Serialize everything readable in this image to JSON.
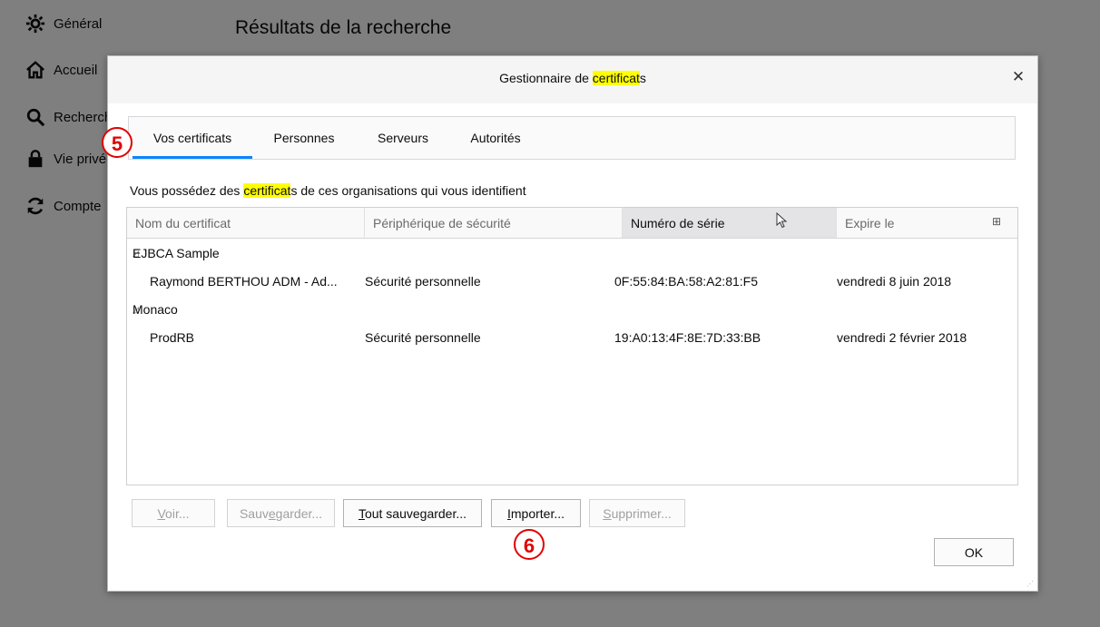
{
  "background": {
    "sidebar": [
      {
        "label": "Général",
        "icon": "gear-icon"
      },
      {
        "label": "Accueil",
        "icon": "home-icon"
      },
      {
        "label": "Recherche",
        "icon": "search-icon"
      },
      {
        "label": "Vie privée",
        "icon": "lock-icon"
      },
      {
        "label": "Compte",
        "icon": "sync-icon"
      }
    ],
    "heading": "Résultats de la recherche"
  },
  "dialog": {
    "title_before": "Gestionnaire de ",
    "title_highlight": "certificat",
    "title_after": "s",
    "tabs": [
      "Vos certificats",
      "Personnes",
      "Serveurs",
      "Autorités"
    ],
    "description_before": "Vous possédez des ",
    "description_highlight": "certificat",
    "description_after": "s de ces organisations qui vous identifient",
    "columns": [
      "Nom du certificat",
      "Périphérique de sécurité",
      "Numéro de série",
      "Expire le"
    ],
    "groups": [
      {
        "name": "EJBCA Sample",
        "certificate": {
          "name": "Raymond BERTHOU ADM - Ad...",
          "device": "Sécurité personnelle",
          "serial": "0F:55:84:BA:58:A2:81:F5",
          "expires": "vendredi 8 juin 2018"
        }
      },
      {
        "name": "Monaco",
        "certificate": {
          "name": "ProdRB",
          "device": "Sécurité personnelle",
          "serial": "19:A0:13:4F:8E:7D:33:BB",
          "expires": "vendredi 2 février 2018"
        }
      }
    ],
    "buttons": {
      "view": {
        "mnemonic": "V",
        "rest": "oir..."
      },
      "save": {
        "before": "Sauv",
        "mnemonic": "e",
        "rest": "garder..."
      },
      "save_all": {
        "mnemonic": "T",
        "rest": "out sauvegarder..."
      },
      "import": {
        "mnemonic": "I",
        "rest": "mporter..."
      },
      "delete": {
        "mnemonic": "S",
        "rest": "upprimer..."
      },
      "ok": "OK"
    }
  },
  "annotations": {
    "tabs_marker": "5",
    "import_marker": "6"
  }
}
